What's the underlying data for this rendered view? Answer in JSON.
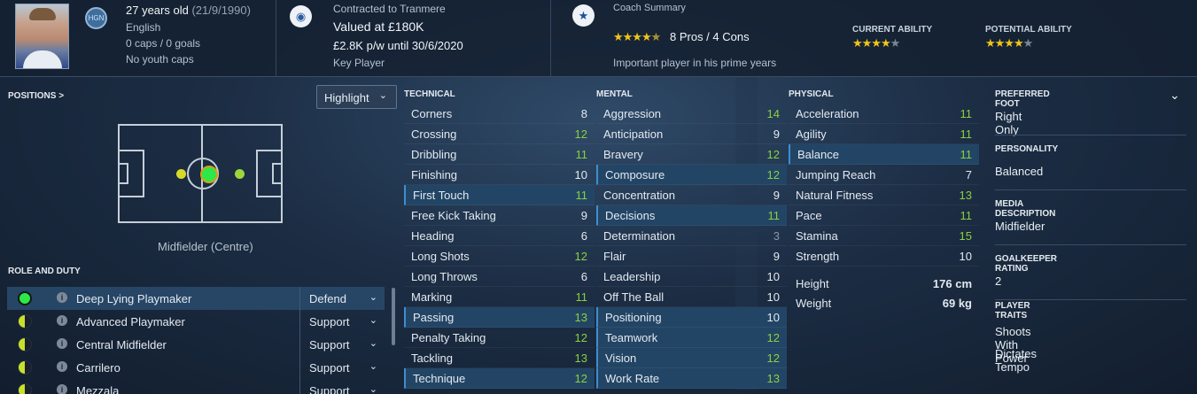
{
  "header": {
    "age": "27 years old",
    "dob": "(21/9/1990)",
    "nationality": "English",
    "caps": "0 caps / 0 goals",
    "youth": "No youth caps",
    "club_badge": "HGN",
    "contract_label": "Contracted to Tranmere",
    "value": "Valued at £180K",
    "wage": "£2.8K p/w until 30/6/2020",
    "status": "Key Player",
    "coach_label": "Coach Summary",
    "pros_cons": "8 Pros / 4 Cons",
    "coach_comment": "Important player in his prime years",
    "current_ability_label": "CURRENT ABILITY",
    "potential_ability_label": "POTENTIAL ABILITY",
    "coach_stars": 4,
    "current_stars": 4,
    "potential_stars": 4
  },
  "positions": {
    "label": "POSITIONS >",
    "highlight_label": "Highlight",
    "position_name": "Midfielder (Centre)"
  },
  "roles": {
    "label": "ROLE AND DUTY",
    "items": [
      {
        "name": "Deep Lying Playmaker",
        "duty": "Defend"
      },
      {
        "name": "Advanced Playmaker",
        "duty": "Support"
      },
      {
        "name": "Central Midfielder",
        "duty": "Support"
      },
      {
        "name": "Carrilero",
        "duty": "Support"
      },
      {
        "name": "Mezzala",
        "duty": "Support"
      }
    ]
  },
  "technical": {
    "label": "TECHNICAL",
    "items": [
      {
        "name": "Corners",
        "value": "8"
      },
      {
        "name": "Crossing",
        "value": "12"
      },
      {
        "name": "Dribbling",
        "value": "11"
      },
      {
        "name": "Finishing",
        "value": "10"
      },
      {
        "name": "First Touch",
        "value": "11"
      },
      {
        "name": "Free Kick Taking",
        "value": "9"
      },
      {
        "name": "Heading",
        "value": "6"
      },
      {
        "name": "Long Shots",
        "value": "12"
      },
      {
        "name": "Long Throws",
        "value": "6"
      },
      {
        "name": "Marking",
        "value": "11"
      },
      {
        "name": "Passing",
        "value": "13"
      },
      {
        "name": "Penalty Taking",
        "value": "12"
      },
      {
        "name": "Tackling",
        "value": "13"
      },
      {
        "name": "Technique",
        "value": "12"
      }
    ]
  },
  "mental": {
    "label": "MENTAL",
    "items": [
      {
        "name": "Aggression",
        "value": "14"
      },
      {
        "name": "Anticipation",
        "value": "9"
      },
      {
        "name": "Bravery",
        "value": "12"
      },
      {
        "name": "Composure",
        "value": "12"
      },
      {
        "name": "Concentration",
        "value": "9"
      },
      {
        "name": "Decisions",
        "value": "11"
      },
      {
        "name": "Determination",
        "value": "3"
      },
      {
        "name": "Flair",
        "value": "9"
      },
      {
        "name": "Leadership",
        "value": "10"
      },
      {
        "name": "Off The Ball",
        "value": "10"
      },
      {
        "name": "Positioning",
        "value": "10"
      },
      {
        "name": "Teamwork",
        "value": "12"
      },
      {
        "name": "Vision",
        "value": "12"
      },
      {
        "name": "Work Rate",
        "value": "13"
      }
    ]
  },
  "physical": {
    "label": "PHYSICAL",
    "items": [
      {
        "name": "Acceleration",
        "value": "11"
      },
      {
        "name": "Agility",
        "value": "11"
      },
      {
        "name": "Balance",
        "value": "11"
      },
      {
        "name": "Jumping Reach",
        "value": "7"
      },
      {
        "name": "Natural Fitness",
        "value": "13"
      },
      {
        "name": "Pace",
        "value": "11"
      },
      {
        "name": "Stamina",
        "value": "15"
      },
      {
        "name": "Strength",
        "value": "10"
      }
    ],
    "height_label": "Height",
    "height": "176 cm",
    "weight_label": "Weight",
    "weight": "69 kg"
  },
  "profile": {
    "foot_label": "PREFERRED FOOT",
    "foot": "Right Only",
    "personality_label": "PERSONALITY",
    "personality": "Balanced",
    "media_label": "MEDIA DESCRIPTION",
    "media": "Midfielder",
    "gk_label": "GOALKEEPER RATING",
    "gk": "2",
    "traits_label": "PLAYER TRAITS",
    "traits": [
      "Shoots With Power",
      "Dictates Tempo"
    ]
  },
  "colors": {
    "accent": "#3f8ed0",
    "good": "#8bd13f",
    "star": "#f0c419",
    "natural_position": "#2ee84a"
  }
}
